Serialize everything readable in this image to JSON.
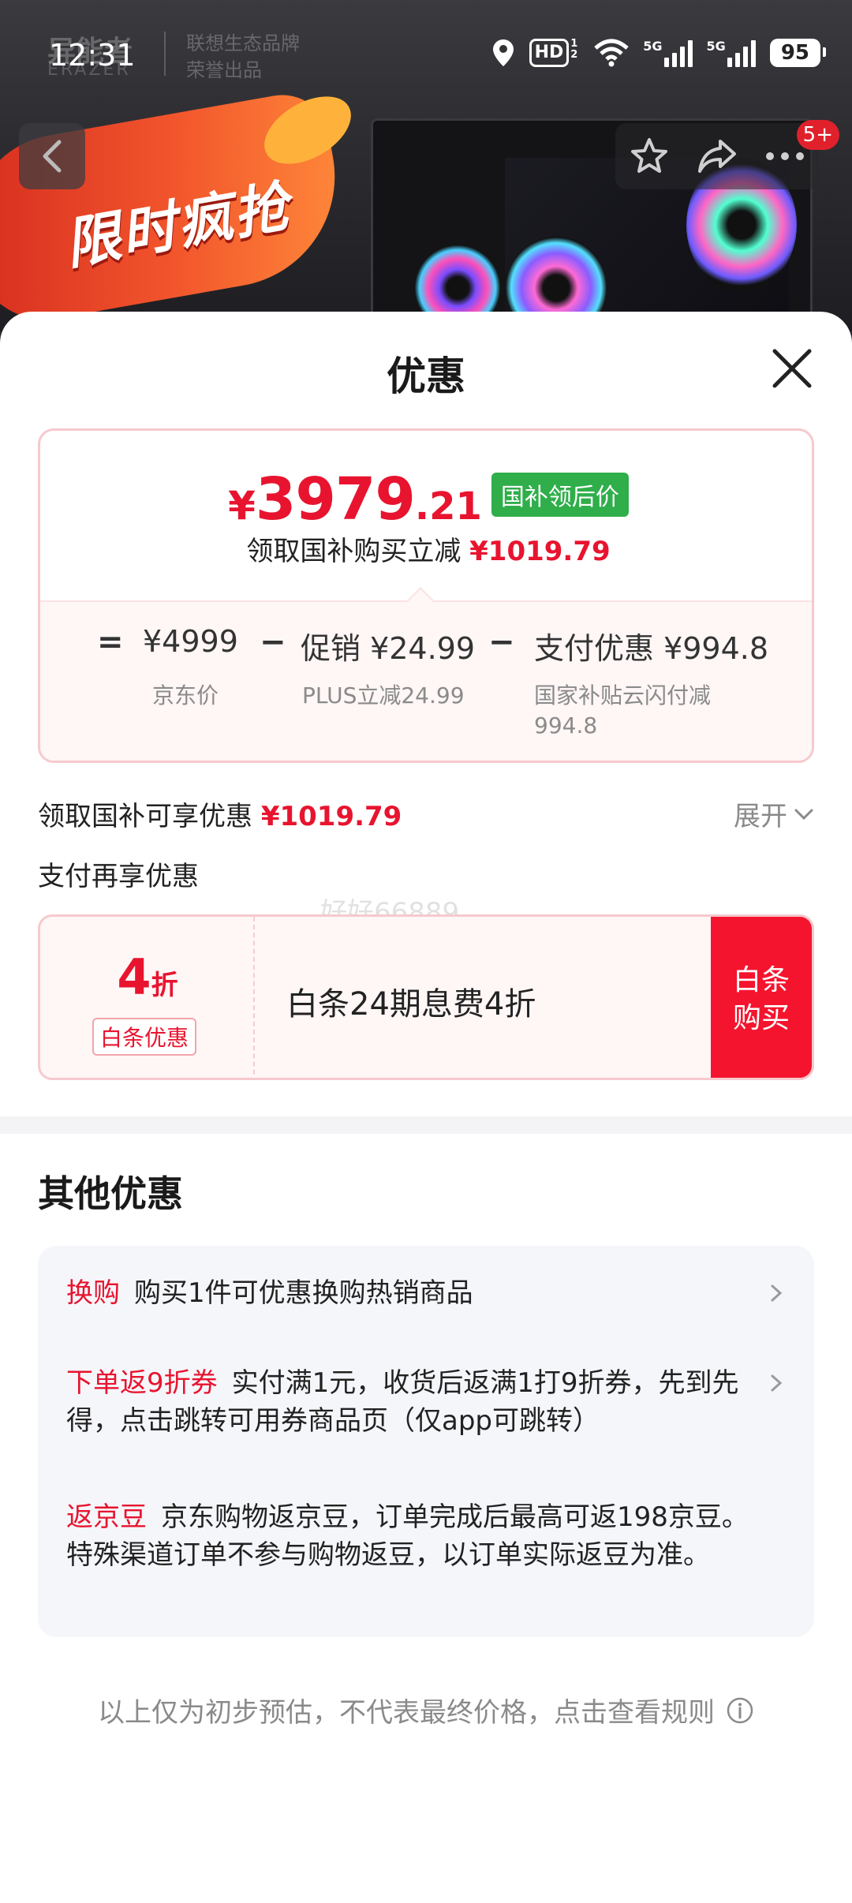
{
  "status_bar": {
    "time": "12:31",
    "hd": "HD",
    "hd_sub": "1 2",
    "sig1": "5G",
    "sig2": "5G",
    "battery": "95"
  },
  "banner": {
    "brand": "异能者",
    "brand_sub": "ERAZER",
    "brand_tag_line1": "联想生态品牌",
    "brand_tag_line2": "荣誉出品",
    "promo_text": "限时疯抢"
  },
  "nav": {
    "badge": "5+"
  },
  "sheet": {
    "title": "优惠"
  },
  "price": {
    "yen": "¥",
    "integer": "3979",
    "decimal": ".21",
    "badge": "国补领后价",
    "subtitle": "领取国补购买立减",
    "subtitle_amount": "¥1019.79"
  },
  "breakdown": {
    "eq": "=",
    "jd_price": "¥4999",
    "jd_caption": "京东价",
    "minus1": "−",
    "promo": "促销 ¥24.99",
    "promo_caption": "PLUS立减24.99",
    "minus2": "−",
    "pay": "支付优惠 ¥994.8",
    "pay_caption": "国家补贴云闪付减 994.8"
  },
  "summary": {
    "label": "领取国补可享优惠",
    "amount": "¥1019.79",
    "expand": "展开",
    "pay_again": "支付再享优惠",
    "watermark": "好好66889"
  },
  "baitiao": {
    "discount_number": "4",
    "discount_unit": "折",
    "tag": "白条优惠",
    "text": "白条24期息费4折",
    "buy_line1": "白条",
    "buy_line2": "购买"
  },
  "other": {
    "title": "其他优惠",
    "items": [
      {
        "tag": "换购",
        "text": "购买1件可优惠换购热销商品"
      },
      {
        "tag": "下单返9折券",
        "text": "实付满1元，收货后返满1打9折券，先到先得，点击跳转可用券商品页（仅app可跳转）"
      },
      {
        "tag": "返京豆",
        "text": "京东购物返京豆，订单完成后最高可返198京豆。特殊渠道订单不参与购物返豆，以订单实际返豆为准。"
      }
    ]
  },
  "footer": {
    "note": "以上仅为初步预估，不代表最终价格，点击查看规则"
  },
  "colors": {
    "accent_red": "#e8142f",
    "badge_green": "#2fae4a",
    "buy_button": "#f5142e"
  }
}
